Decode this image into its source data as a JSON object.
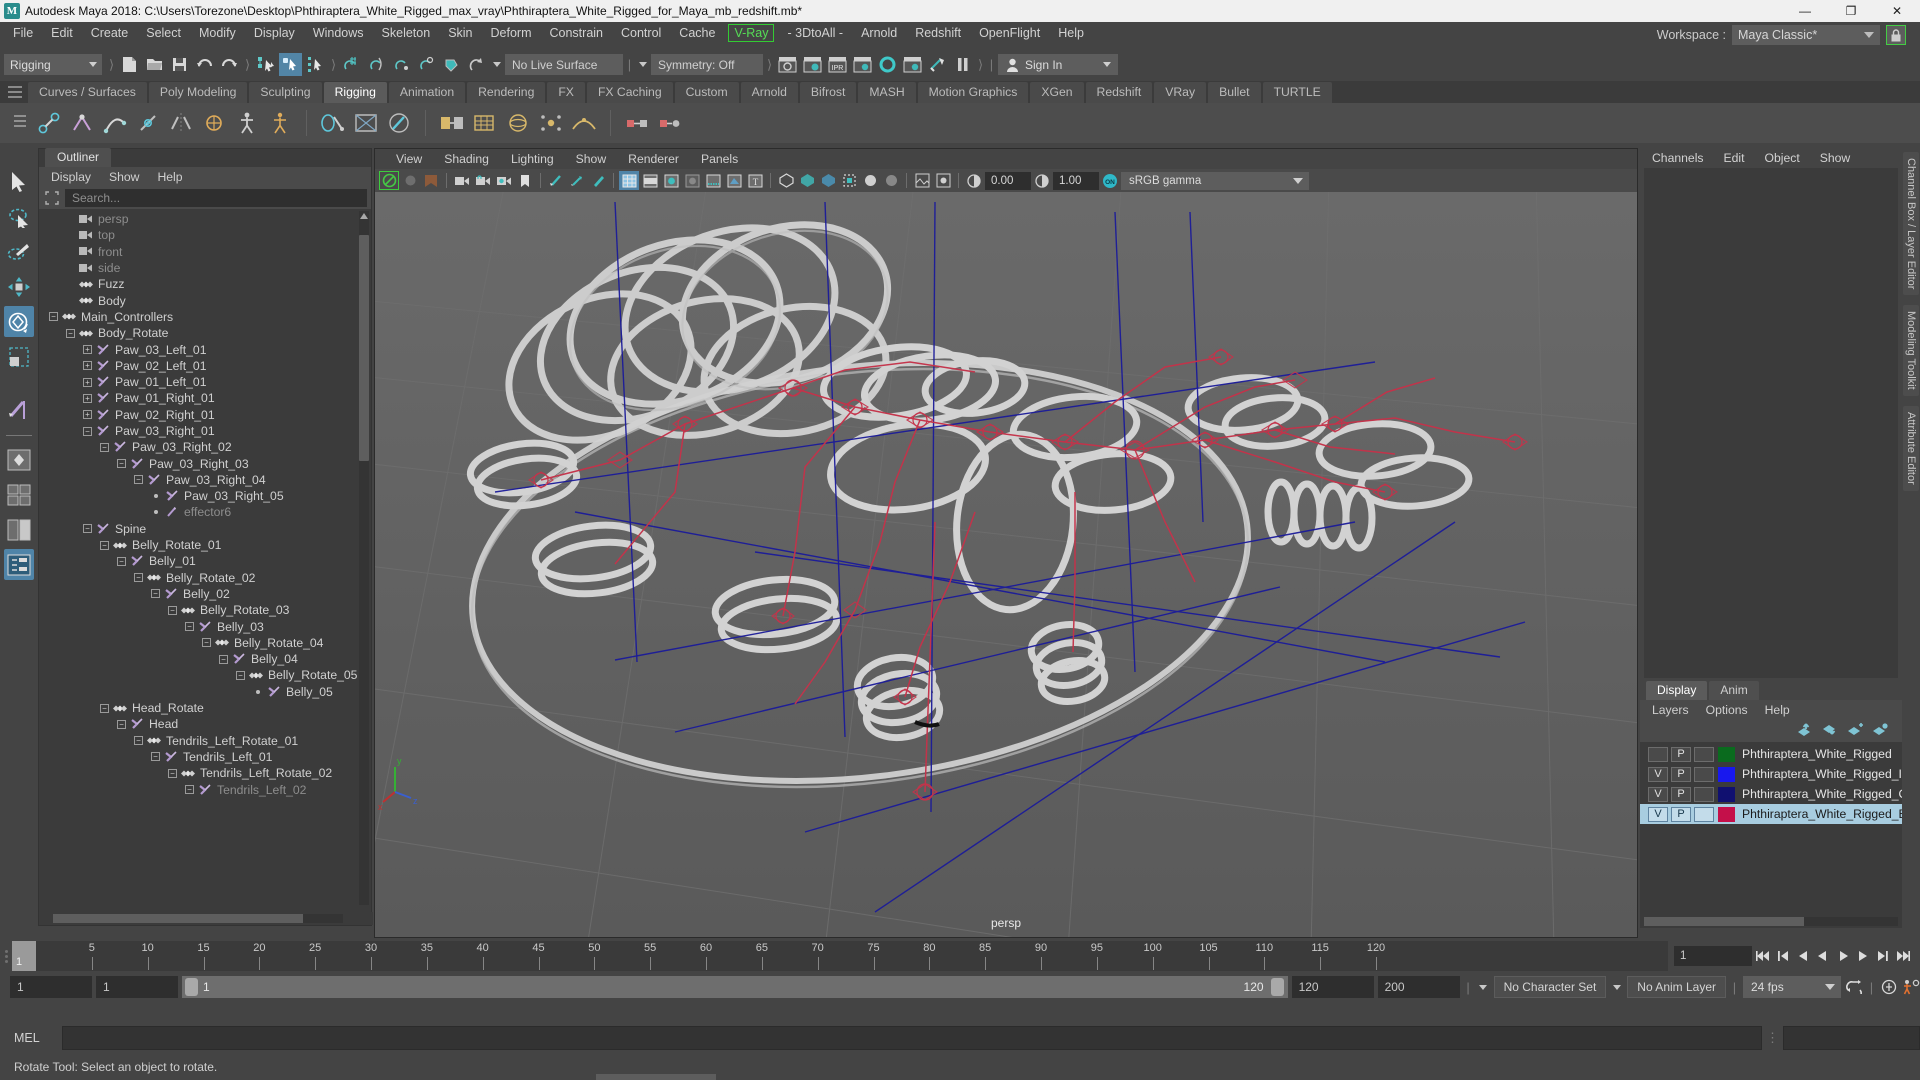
{
  "titlebar": {
    "app_icon": "maya-logo",
    "title": "Autodesk Maya 2018: C:\\Users\\Torezone\\Desktop\\Phthiraptera_White_Rigged_max_vray\\Phthiraptera_White_Rigged_for_Maya_mb_redshift.mb*",
    "minimize": "—",
    "maximize": "❐",
    "close": "✕"
  },
  "menubar": {
    "items": [
      {
        "label": "File"
      },
      {
        "label": "Edit"
      },
      {
        "label": "Create"
      },
      {
        "label": "Select"
      },
      {
        "label": "Modify"
      },
      {
        "label": "Display"
      },
      {
        "label": "Windows"
      },
      {
        "label": "Skeleton"
      },
      {
        "label": "Skin"
      },
      {
        "label": "Deform"
      },
      {
        "label": "Constrain"
      },
      {
        "label": "Control"
      },
      {
        "label": "Cache"
      },
      {
        "label": "V-Ray"
      },
      {
        "label": "- 3DtoAll -"
      },
      {
        "label": "Arnold"
      },
      {
        "label": "Redshift"
      },
      {
        "label": "OpenFlight"
      },
      {
        "label": "Help"
      }
    ],
    "workspace_label": "Workspace :",
    "workspace_value": "Maya Classic*",
    "lock_icon": "lock-icon"
  },
  "statusline": {
    "mode_menu": "Rigging",
    "no_live_surface": "No Live Surface",
    "symmetry": "Symmetry: Off",
    "sign_in": "Sign In"
  },
  "shelf": {
    "tabs": [
      {
        "label": "Curves / Surfaces"
      },
      {
        "label": "Poly Modeling"
      },
      {
        "label": "Sculpting"
      },
      {
        "label": "Rigging",
        "active": true
      },
      {
        "label": "Animation"
      },
      {
        "label": "Rendering"
      },
      {
        "label": "FX"
      },
      {
        "label": "FX Caching"
      },
      {
        "label": "Custom"
      },
      {
        "label": "Arnold"
      },
      {
        "label": "Bifrost"
      },
      {
        "label": "MASH"
      },
      {
        "label": "Motion Graphics"
      },
      {
        "label": "XGen"
      },
      {
        "label": "Redshift"
      },
      {
        "label": "VRay"
      },
      {
        "label": "Bullet"
      },
      {
        "label": "TURTLE"
      }
    ]
  },
  "outliner": {
    "tab_label": "Outliner",
    "menu": [
      {
        "label": "Display"
      },
      {
        "label": "Show"
      },
      {
        "label": "Help"
      }
    ],
    "search_placeholder": "Search...",
    "tree": [
      {
        "label": "persp",
        "depth": 1,
        "toggle": "none",
        "icon": "camera",
        "dim": true
      },
      {
        "label": "top",
        "depth": 1,
        "toggle": "none",
        "icon": "camera",
        "dim": true
      },
      {
        "label": "front",
        "depth": 1,
        "toggle": "none",
        "icon": "camera",
        "dim": true
      },
      {
        "label": "side",
        "depth": 1,
        "toggle": "none",
        "icon": "camera",
        "dim": true
      },
      {
        "label": "Fuzz",
        "depth": 1,
        "toggle": "none",
        "icon": "transform"
      },
      {
        "label": "Body",
        "depth": 1,
        "toggle": "none",
        "icon": "transform"
      },
      {
        "label": "Main_Controllers",
        "depth": 0,
        "toggle": "minus",
        "icon": "transform"
      },
      {
        "label": "Body_Rotate",
        "depth": 1,
        "toggle": "minus",
        "icon": "transform"
      },
      {
        "label": "Paw_03_Left_01",
        "depth": 2,
        "toggle": "plus",
        "icon": "joint"
      },
      {
        "label": "Paw_02_Left_01",
        "depth": 2,
        "toggle": "plus",
        "icon": "joint"
      },
      {
        "label": "Paw_01_Left_01",
        "depth": 2,
        "toggle": "plus",
        "icon": "joint"
      },
      {
        "label": "Paw_01_Right_01",
        "depth": 2,
        "toggle": "plus",
        "icon": "joint"
      },
      {
        "label": "Paw_02_Right_01",
        "depth": 2,
        "toggle": "plus",
        "icon": "joint"
      },
      {
        "label": "Paw_03_Right_01",
        "depth": 2,
        "toggle": "minus",
        "icon": "joint"
      },
      {
        "label": "Paw_03_Right_02",
        "depth": 3,
        "toggle": "minus",
        "icon": "joint"
      },
      {
        "label": "Paw_03_Right_03",
        "depth": 4,
        "toggle": "minus",
        "icon": "joint"
      },
      {
        "label": "Paw_03_Right_04",
        "depth": 5,
        "toggle": "minus",
        "icon": "joint"
      },
      {
        "label": "Paw_03_Right_05",
        "depth": 6,
        "toggle": "dot",
        "icon": "joint"
      },
      {
        "label": "effector6",
        "depth": 6,
        "toggle": "dot",
        "icon": "effector",
        "dim": true
      },
      {
        "label": "Spine",
        "depth": 2,
        "toggle": "minus",
        "icon": "joint"
      },
      {
        "label": "Belly_Rotate_01",
        "depth": 3,
        "toggle": "minus",
        "icon": "transform"
      },
      {
        "label": "Belly_01",
        "depth": 4,
        "toggle": "minus",
        "icon": "joint"
      },
      {
        "label": "Belly_Rotate_02",
        "depth": 5,
        "toggle": "minus",
        "icon": "transform"
      },
      {
        "label": "Belly_02",
        "depth": 6,
        "toggle": "minus",
        "icon": "joint"
      },
      {
        "label": "Belly_Rotate_03",
        "depth": 7,
        "toggle": "minus",
        "icon": "transform"
      },
      {
        "label": "Belly_03",
        "depth": 8,
        "toggle": "minus",
        "icon": "joint"
      },
      {
        "label": "Belly_Rotate_04",
        "depth": 9,
        "toggle": "minus",
        "icon": "transform"
      },
      {
        "label": "Belly_04",
        "depth": 10,
        "toggle": "minus",
        "icon": "joint"
      },
      {
        "label": "Belly_Rotate_05",
        "depth": 11,
        "toggle": "minus",
        "icon": "transform"
      },
      {
        "label": "Belly_05",
        "depth": 12,
        "toggle": "dot",
        "icon": "joint"
      },
      {
        "label": "Head_Rotate",
        "depth": 3,
        "toggle": "minus",
        "icon": "transform"
      },
      {
        "label": "Head",
        "depth": 4,
        "toggle": "minus",
        "icon": "joint"
      },
      {
        "label": "Tendrils_Left_Rotate_01",
        "depth": 5,
        "toggle": "minus",
        "icon": "transform"
      },
      {
        "label": "Tendrils_Left_01",
        "depth": 6,
        "toggle": "minus",
        "icon": "joint"
      },
      {
        "label": "Tendrils_Left_Rotate_02",
        "depth": 7,
        "toggle": "minus",
        "icon": "transform"
      },
      {
        "label": "Tendrils_Left_02",
        "depth": 8,
        "toggle": "minus",
        "icon": "joint",
        "dim": true
      }
    ]
  },
  "viewport": {
    "menu": [
      {
        "label": "View"
      },
      {
        "label": "Shading"
      },
      {
        "label": "Lighting"
      },
      {
        "label": "Show"
      },
      {
        "label": "Renderer"
      },
      {
        "label": "Panels"
      }
    ],
    "exposure": "0.00",
    "gamma": "1.00",
    "color_space": "sRGB gamma",
    "camera_label": "persp",
    "axis_labels": {
      "x": "x",
      "y": "y",
      "z": "z"
    }
  },
  "channelbox": {
    "menu": [
      {
        "label": "Channels"
      },
      {
        "label": "Edit"
      },
      {
        "label": "Object"
      },
      {
        "label": "Show"
      }
    ]
  },
  "layers": {
    "tabs": [
      {
        "label": "Display",
        "active": true
      },
      {
        "label": "Anim"
      }
    ],
    "menu": [
      {
        "label": "Layers"
      },
      {
        "label": "Options"
      },
      {
        "label": "Help"
      }
    ],
    "rows": [
      {
        "v": "",
        "p": "P",
        "third": "",
        "color": "#0a6b1e",
        "name": "Phthiraptera_White_Rigged",
        "selected": false
      },
      {
        "v": "V",
        "p": "P",
        "third": "",
        "color": "#1818ee",
        "name": "Phthiraptera_White_Rigged_IK",
        "selected": false
      },
      {
        "v": "V",
        "p": "P",
        "third": "",
        "color": "#101070",
        "name": "Phthiraptera_White_Rigged_C",
        "selected": false
      },
      {
        "v": "V",
        "p": "P",
        "third": "",
        "color": "#c4104a",
        "name": "Phthiraptera_White_Rigged_B",
        "selected": true
      }
    ]
  },
  "vertical_tabs": [
    {
      "label": "Channel Box / Layer Editor"
    },
    {
      "label": "Modeling Toolkit"
    },
    {
      "label": "Attribute Editor"
    }
  ],
  "timeline": {
    "current_frame": "1",
    "ticks": [
      5,
      10,
      15,
      20,
      25,
      30,
      35,
      40,
      45,
      50,
      55,
      60,
      65,
      70,
      75,
      80,
      85,
      90,
      95,
      100,
      105,
      110,
      115,
      120
    ],
    "range_start_field": "1",
    "range_start2_field": "1",
    "slider_left_value": "1",
    "slider_right_value": "120",
    "range_end_field": "120",
    "playback_end_field": "200",
    "character_set": "No Character Set",
    "anim_layer": "No Anim Layer",
    "fps": "24 fps"
  },
  "command_line": {
    "label": "MEL",
    "value": ""
  },
  "statusbar": {
    "message": "Rotate Tool: Select an object to rotate."
  }
}
